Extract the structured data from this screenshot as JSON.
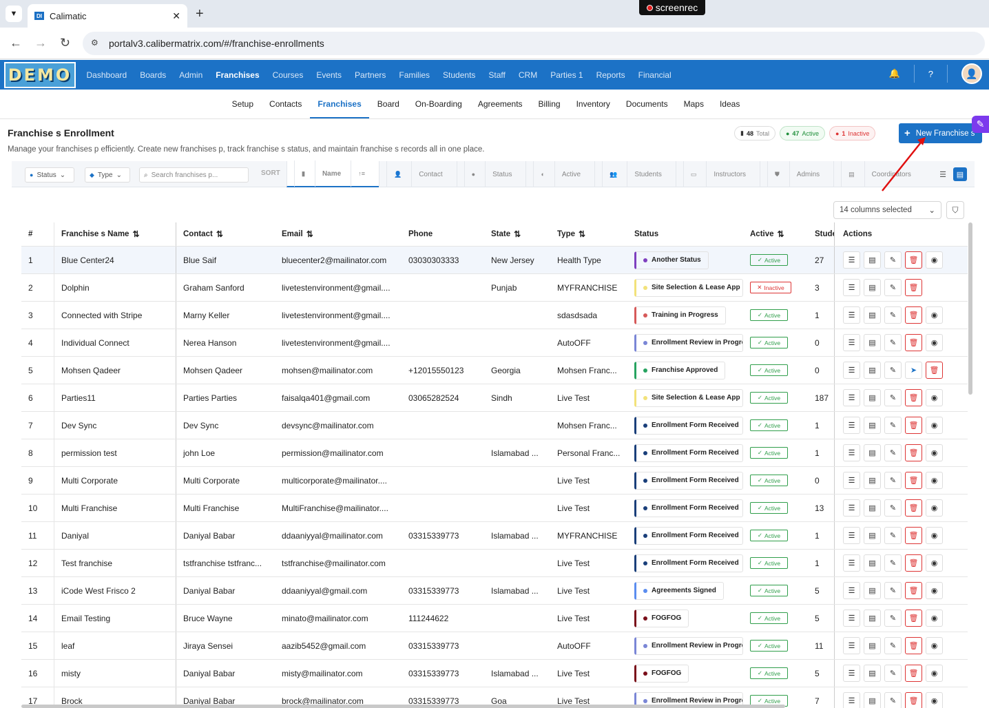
{
  "browser": {
    "tab_title": "Calimatic",
    "tab_favicon": "DI",
    "url": "portalv3.calibermatrix.com/#/franchise-enrollments",
    "recorder_label": "screenrec"
  },
  "app": {
    "logo_text": "DEMO",
    "accent": "#1c72c6",
    "main_nav": [
      "Dashboard",
      "Boards",
      "Admin",
      "Franchises",
      "Courses",
      "Events",
      "Partners",
      "Families",
      "Students",
      "Staff",
      "CRM",
      "Parties 1",
      "Reports",
      "Financial"
    ],
    "main_nav_active": "Franchises",
    "sub_nav": [
      "Setup",
      "Contacts",
      "Franchises",
      "Board",
      "On-Boarding",
      "Agreements",
      "Billing",
      "Inventory",
      "Documents",
      "Maps",
      "Ideas"
    ],
    "sub_nav_active": "Franchises"
  },
  "page": {
    "title": "Franchise s Enrollment",
    "description": "Manage your franchises p efficiently. Create new franchises p, track franchise s status, and maintain franchise s records all in one place.",
    "stats": {
      "total_count": "48",
      "total_label": "Total",
      "active_count": "47",
      "active_label": "Active",
      "inactive_count": "1",
      "inactive_label": "Inactive"
    },
    "new_button": "New Franchise s"
  },
  "filters": {
    "status_label": "Status",
    "type_label": "Type",
    "search_placeholder": "Search franchises p...",
    "sort_label": "SORT",
    "sort_options": [
      "Name",
      "Contact",
      "Status",
      "Active",
      "Students",
      "Instructors",
      "Admins",
      "Coordinators"
    ],
    "sort_active": "Name",
    "columns_selected": "14 columns selected"
  },
  "table": {
    "headers": [
      "#",
      "Franchise s Name",
      "Contact",
      "Email",
      "Phone",
      "State",
      "Type",
      "Status",
      "Active",
      "Stude",
      "Actions"
    ],
    "rows": [
      {
        "num": "1",
        "name": "Blue Center24",
        "contact": "Blue Saif",
        "email": "bluecenter2@mailinator.com",
        "phone": "03030303333",
        "state": "New Jersey",
        "type": "Health Type",
        "status": "Another Status",
        "status_color": "#7e3fbf",
        "active": "Active",
        "students": "27",
        "actions": [
          "settings",
          "list",
          "edit",
          "delete",
          "view"
        ]
      },
      {
        "num": "2",
        "name": "Dolphin",
        "contact": "Graham Sanford",
        "email": "livetestenvironment@gmail....",
        "phone": "",
        "state": "Punjab",
        "type": "MYFRANCHISE",
        "status": "Site Selection & Lease App",
        "status_color": "#f2e27a",
        "active": "Inactive",
        "students": "3",
        "actions": [
          "settings",
          "list",
          "edit",
          "delete"
        ]
      },
      {
        "num": "3",
        "name": "Connected with Stripe",
        "contact": "Marny Keller",
        "email": "livetestenvironment@gmail....",
        "phone": "",
        "state": "",
        "type": "sdasdsada",
        "status": "Training in Progress",
        "status_color": "#d65a5a",
        "active": "Active",
        "students": "1",
        "actions": [
          "settings",
          "list",
          "edit",
          "delete",
          "view"
        ]
      },
      {
        "num": "4",
        "name": "Individual Connect",
        "contact": "Nerea Hanson",
        "email": "livetestenvironment@gmail....",
        "phone": "",
        "state": "",
        "type": "AutoOFF",
        "status": "Enrollment Review in Progre",
        "status_color": "#7a86d6",
        "active": "Active",
        "students": "0",
        "actions": [
          "settings",
          "list",
          "edit",
          "delete",
          "view"
        ]
      },
      {
        "num": "5",
        "name": "Mohsen Qadeer",
        "contact": "Mohsen Qadeer",
        "email": "mohsen@mailinator.com",
        "phone": "+12015550123",
        "state": "Georgia",
        "type": "Mohsen Franc...",
        "status": "Franchise Approved",
        "status_color": "#27a360",
        "active": "Active",
        "students": "0",
        "actions": [
          "settings",
          "list",
          "edit",
          "send",
          "delete"
        ]
      },
      {
        "num": "6",
        "name": "Parties11",
        "contact": "Parties Parties",
        "email": "faisalqa401@gmail.com",
        "phone": "03065282524",
        "state": "Sindh",
        "type": "Live Test",
        "status": "Site Selection & Lease App",
        "status_color": "#f2e27a",
        "active": "Active",
        "students": "187",
        "actions": [
          "settings",
          "list",
          "edit",
          "delete",
          "view"
        ]
      },
      {
        "num": "7",
        "name": "Dev Sync",
        "contact": "Dev Sync",
        "email": "devsync@mailinator.com",
        "phone": "",
        "state": "",
        "type": "Mohsen Franc...",
        "status": "Enrollment Form Received",
        "status_color": "#1a3f7a",
        "active": "Active",
        "students": "1",
        "actions": [
          "settings",
          "list",
          "edit",
          "delete",
          "view"
        ]
      },
      {
        "num": "8",
        "name": "permission test",
        "contact": "john Loe",
        "email": "permission@mailinator.com",
        "phone": "",
        "state": "Islamabad ...",
        "type": "Personal Franc...",
        "status": "Enrollment Form Received",
        "status_color": "#1a3f7a",
        "active": "Active",
        "students": "1",
        "actions": [
          "settings",
          "list",
          "edit",
          "delete",
          "view"
        ]
      },
      {
        "num": "9",
        "name": "Multi Corporate",
        "contact": "Multi Corporate",
        "email": "multicorporate@mailinator....",
        "phone": "",
        "state": "",
        "type": "Live Test",
        "status": "Enrollment Form Received",
        "status_color": "#1a3f7a",
        "active": "Active",
        "students": "0",
        "actions": [
          "settings",
          "list",
          "edit",
          "delete",
          "view"
        ]
      },
      {
        "num": "10",
        "name": "Multi Franchise",
        "contact": "Multi Franchise",
        "email": "MultiFranchise@mailinator....",
        "phone": "",
        "state": "",
        "type": "Live Test",
        "status": "Enrollment Form Received",
        "status_color": "#1a3f7a",
        "active": "Active",
        "students": "13",
        "actions": [
          "settings",
          "list",
          "edit",
          "delete",
          "view"
        ]
      },
      {
        "num": "11",
        "name": "Daniyal",
        "contact": "Daniyal Babar",
        "email": "ddaaniyyal@mailinator.com",
        "phone": "03315339773",
        "state": "Islamabad ...",
        "type": "MYFRANCHISE",
        "status": "Enrollment Form Received",
        "status_color": "#1a3f7a",
        "active": "Active",
        "students": "1",
        "actions": [
          "settings",
          "list",
          "edit",
          "delete",
          "view"
        ]
      },
      {
        "num": "12",
        "name": "Test franchise",
        "contact": "tstfranchise tstfranc...",
        "email": "tstfranchise@mailinator.com",
        "phone": "",
        "state": "",
        "type": "Live Test",
        "status": "Enrollment Form Received",
        "status_color": "#1a3f7a",
        "active": "Active",
        "students": "1",
        "actions": [
          "settings",
          "list",
          "edit",
          "delete",
          "view"
        ]
      },
      {
        "num": "13",
        "name": "iCode West Frisco 2",
        "contact": "Daniyal Babar",
        "email": "ddaaniyyal@gmail.com",
        "phone": "03315339773",
        "state": "Islamabad ...",
        "type": "Live Test",
        "status": "Agreements Signed",
        "status_color": "#5b8def",
        "active": "Active",
        "students": "5",
        "actions": [
          "settings",
          "list",
          "edit",
          "delete",
          "view"
        ]
      },
      {
        "num": "14",
        "name": "Email Testing",
        "contact": "Bruce Wayne",
        "email": "minato@mailinator.com",
        "phone": "111244622",
        "state": "",
        "type": "Live Test",
        "status": "FOGFOG",
        "status_color": "#7a0f1a",
        "active": "Active",
        "students": "5",
        "actions": [
          "settings",
          "list",
          "edit",
          "delete",
          "view"
        ]
      },
      {
        "num": "15",
        "name": "leaf",
        "contact": "Jiraya Sensei",
        "email": "aazib5452@gmail.com",
        "phone": "03315339773",
        "state": "",
        "type": "AutoOFF",
        "status": "Enrollment Review in Progre",
        "status_color": "#7a86d6",
        "active": "Active",
        "students": "11",
        "actions": [
          "settings",
          "list",
          "edit",
          "delete",
          "view"
        ]
      },
      {
        "num": "16",
        "name": "misty",
        "contact": "Daniyal Babar",
        "email": "misty@mailinator.com",
        "phone": "03315339773",
        "state": "Islamabad ...",
        "type": "Live Test",
        "status": "FOGFOG",
        "status_color": "#7a0f1a",
        "active": "Active",
        "students": "5",
        "actions": [
          "settings",
          "list",
          "edit",
          "delete",
          "view"
        ]
      },
      {
        "num": "17",
        "name": "Brock",
        "contact": "Daniyal Babar",
        "email": "brock@mailinator.com",
        "phone": "03315339773",
        "state": "Goa",
        "type": "Live Test",
        "status": "Enrollment Review in Progre",
        "status_color": "#7a86d6",
        "active": "Active",
        "students": "7",
        "actions": [
          "settings",
          "list",
          "edit",
          "delete",
          "view"
        ]
      }
    ]
  }
}
